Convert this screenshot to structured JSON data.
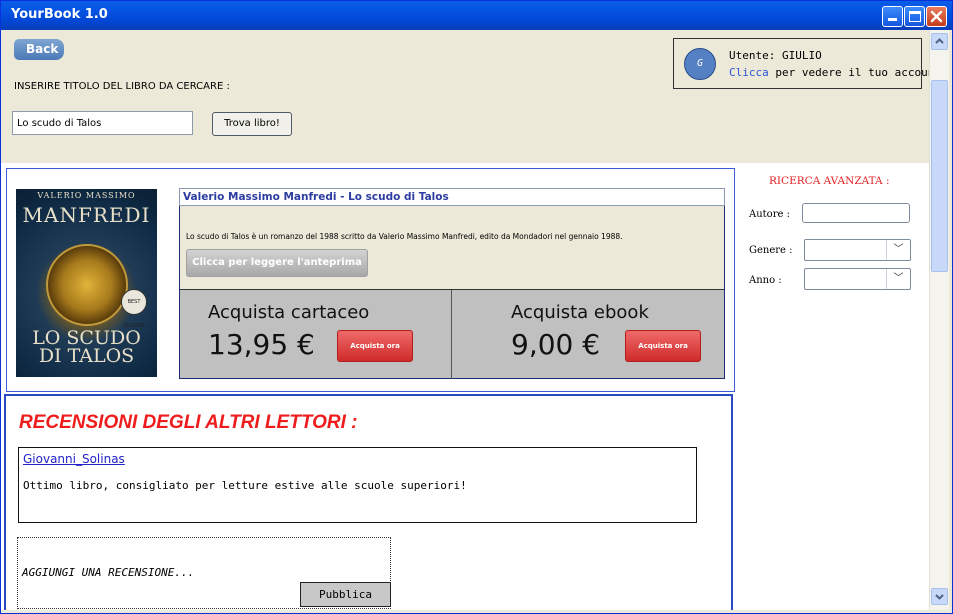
{
  "window": {
    "title": "YourBook 1.0",
    "close_color": "#c43c1c",
    "titlebar_color": "#0451e0"
  },
  "toolbar": {
    "back_label": "Back"
  },
  "search": {
    "label": "INSERIRE TITOLO DEL LIBRO DA CERCARE  :",
    "value": "Lo scudo di Talos",
    "button_label": "Trova libro!"
  },
  "user": {
    "avatar_initial": "G",
    "line1": "Utente: GIULIO",
    "link_text": "Clicca",
    "line2_rest": " per vedere il tuo account"
  },
  "book": {
    "cover": {
      "author_top": "VALERIO MASSIMO",
      "author_name": "MANFREDI",
      "title_line1": "LO SCUDO",
      "title_line2": "DI TALOS",
      "badge": "BEST SELLERS"
    },
    "header": "Valerio Massimo Manfredi - Lo scudo di Talos",
    "description": "Lo scudo di Talos è un romanzo del 1988 scritto da Valerio Massimo Manfredi, edito da Mondadori nel gennaio 1988.",
    "preview_label": "Clicca per leggere l'anteprima",
    "paper": {
      "title": "Acquista cartaceo",
      "price": "13,95 €",
      "button": "Acquista ora"
    },
    "ebook": {
      "title": "Acquista ebook",
      "price": "9,00 €",
      "button": "Acquista ora"
    }
  },
  "reviews": {
    "title": "RECENSIONI DEGLI ALTRI LETTORI :",
    "items": [
      {
        "user": "Giovanni_Solinas",
        "text": "Ottimo libro, consigliato per letture estive alle scuole superiori!"
      }
    ],
    "add_placeholder": "AGGIUNGI UNA RECENSIONE...",
    "publish_label": "Pubblica"
  },
  "advanced_search": {
    "title": "RICERCA AVANZATA :",
    "author_label": "Autore :",
    "genre_label": "Genere :",
    "year_label": "Anno :"
  }
}
